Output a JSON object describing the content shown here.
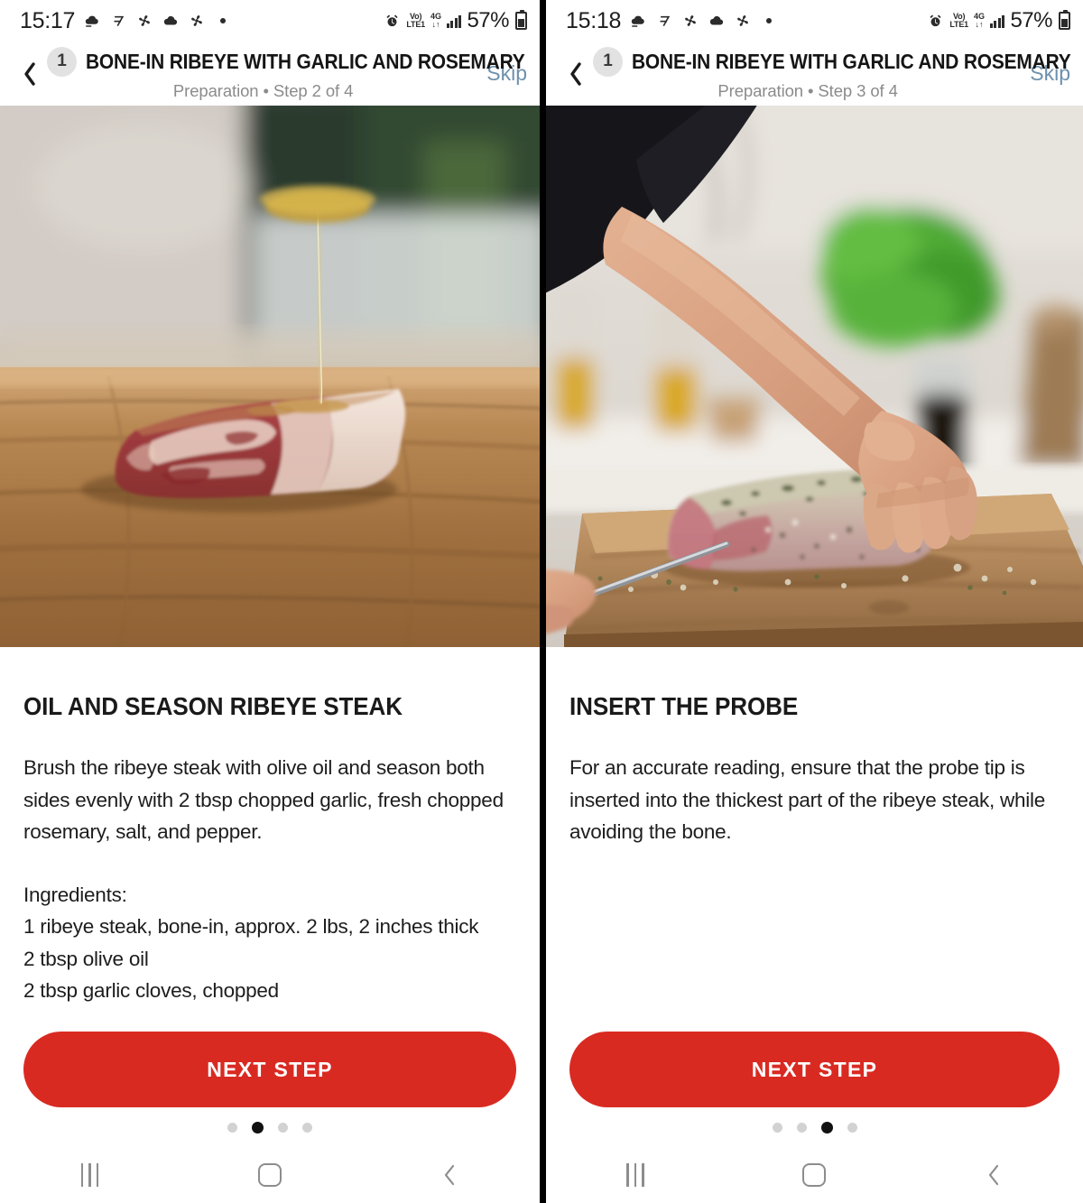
{
  "app": {
    "accent_red": "#d92a22",
    "skip_color": "#6d90ad",
    "badge_bg": "#e2e2e2"
  },
  "panels": [
    {
      "status": {
        "time": "15:17",
        "battery_percent": "57%",
        "volte_top": "Vo)",
        "volte_bottom": "LTE1",
        "network_top": "4G",
        "network_bottom": "↓↑",
        "icons": [
          "cloud-download-icon",
          "seven-day-icon",
          "fan-icon",
          "cloud-icon",
          "fan-icon",
          "dot-icon"
        ],
        "right_icons": [
          "alarm-icon",
          "volte-icon",
          "data-4g-icon",
          "signal-bars-icon",
          "battery-icon"
        ]
      },
      "header": {
        "back_icon": "chevron-left-icon",
        "step_badge": "1",
        "title": "BONE-IN RIBEYE WITH GARLIC AND ROSEMARY",
        "subtitle": "Preparation • Step 2 of 4",
        "skip_label": "Skip"
      },
      "hero": {
        "alt": "Olive oil being drizzled over a raw bone-in ribeye steak on a wooden cutting board"
      },
      "body": {
        "section_title": "OIL AND SEASON RIBEYE STEAK",
        "paragraph": "Brush the ribeye steak with olive oil and season both sides evenly with 2 tbsp chopped garlic, fresh chopped rosemary, salt, and pepper.",
        "ingredients_label": "Ingredients:",
        "ingredients": [
          "1 ribeye steak, bone-in, approx. 2 lbs, 2 inches thick",
          "2 tbsp olive oil",
          "2 tbsp garlic cloves, chopped"
        ]
      },
      "cta_label": "NEXT STEP",
      "pagination": {
        "total": 4,
        "active_index": 1
      },
      "navbar": {
        "recents_icon": "recents-icon",
        "home_icon": "home-icon",
        "back_icon": "back-chevron-icon"
      }
    },
    {
      "status": {
        "time": "15:18",
        "battery_percent": "57%",
        "volte_top": "Vo)",
        "volte_bottom": "LTE1",
        "network_top": "4G",
        "network_bottom": "↓↑",
        "icons": [
          "cloud-download-icon",
          "seven-day-icon",
          "fan-icon",
          "cloud-icon",
          "fan-icon",
          "dot-icon"
        ],
        "right_icons": [
          "alarm-icon",
          "volte-icon",
          "data-4g-icon",
          "signal-bars-icon",
          "battery-icon"
        ]
      },
      "header": {
        "back_icon": "chevron-left-icon",
        "step_badge": "1",
        "title": "BONE-IN RIBEYE WITH GARLIC AND ROSEMARY",
        "subtitle": "Preparation • Step 3 of 4",
        "skip_label": "Skip"
      },
      "hero": {
        "alt": "A hand inserting a temperature probe into a seasoned ribeye steak on a wooden board"
      },
      "body": {
        "section_title": "INSERT THE PROBE",
        "paragraph": "For an accurate reading, ensure that the probe tip is inserted into the thickest part of the ribeye steak, while avoiding the bone.",
        "ingredients_label": "",
        "ingredients": []
      },
      "cta_label": "NEXT STEP",
      "pagination": {
        "total": 4,
        "active_index": 2
      },
      "navbar": {
        "recents_icon": "recents-icon",
        "home_icon": "home-icon",
        "back_icon": "back-chevron-icon"
      }
    }
  ]
}
